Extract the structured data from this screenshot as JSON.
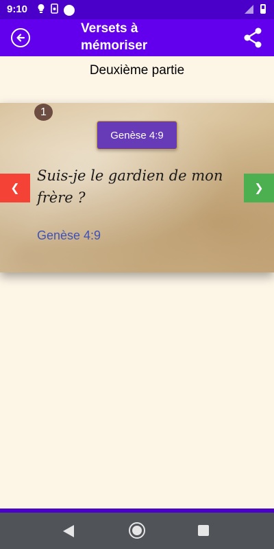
{
  "status_bar": {
    "time": "9:10",
    "icons": [
      "lightbulb-icon",
      "phone-icon",
      "p-icon",
      "signal-icon",
      "battery-icon"
    ],
    "p_letter": "P"
  },
  "app_bar": {
    "title": "Versets à mémoriser",
    "color": "#6200ee",
    "back_icon": "back-arrow-icon",
    "share_icon": "share-icon"
  },
  "section": {
    "title": "Deuxième partie"
  },
  "card": {
    "counter": "1",
    "reference_chip": "Genèse 4:9",
    "verse": "Suis-je le gardien de mon frère ?",
    "reference_link": "Genèse 4:9",
    "prev_label": "❮",
    "next_label": "❯",
    "prev_color": "#f44336",
    "next_color": "#4caf50"
  },
  "nav_bar": {
    "buttons": [
      "back-icon",
      "home-icon",
      "recents-icon"
    ]
  }
}
